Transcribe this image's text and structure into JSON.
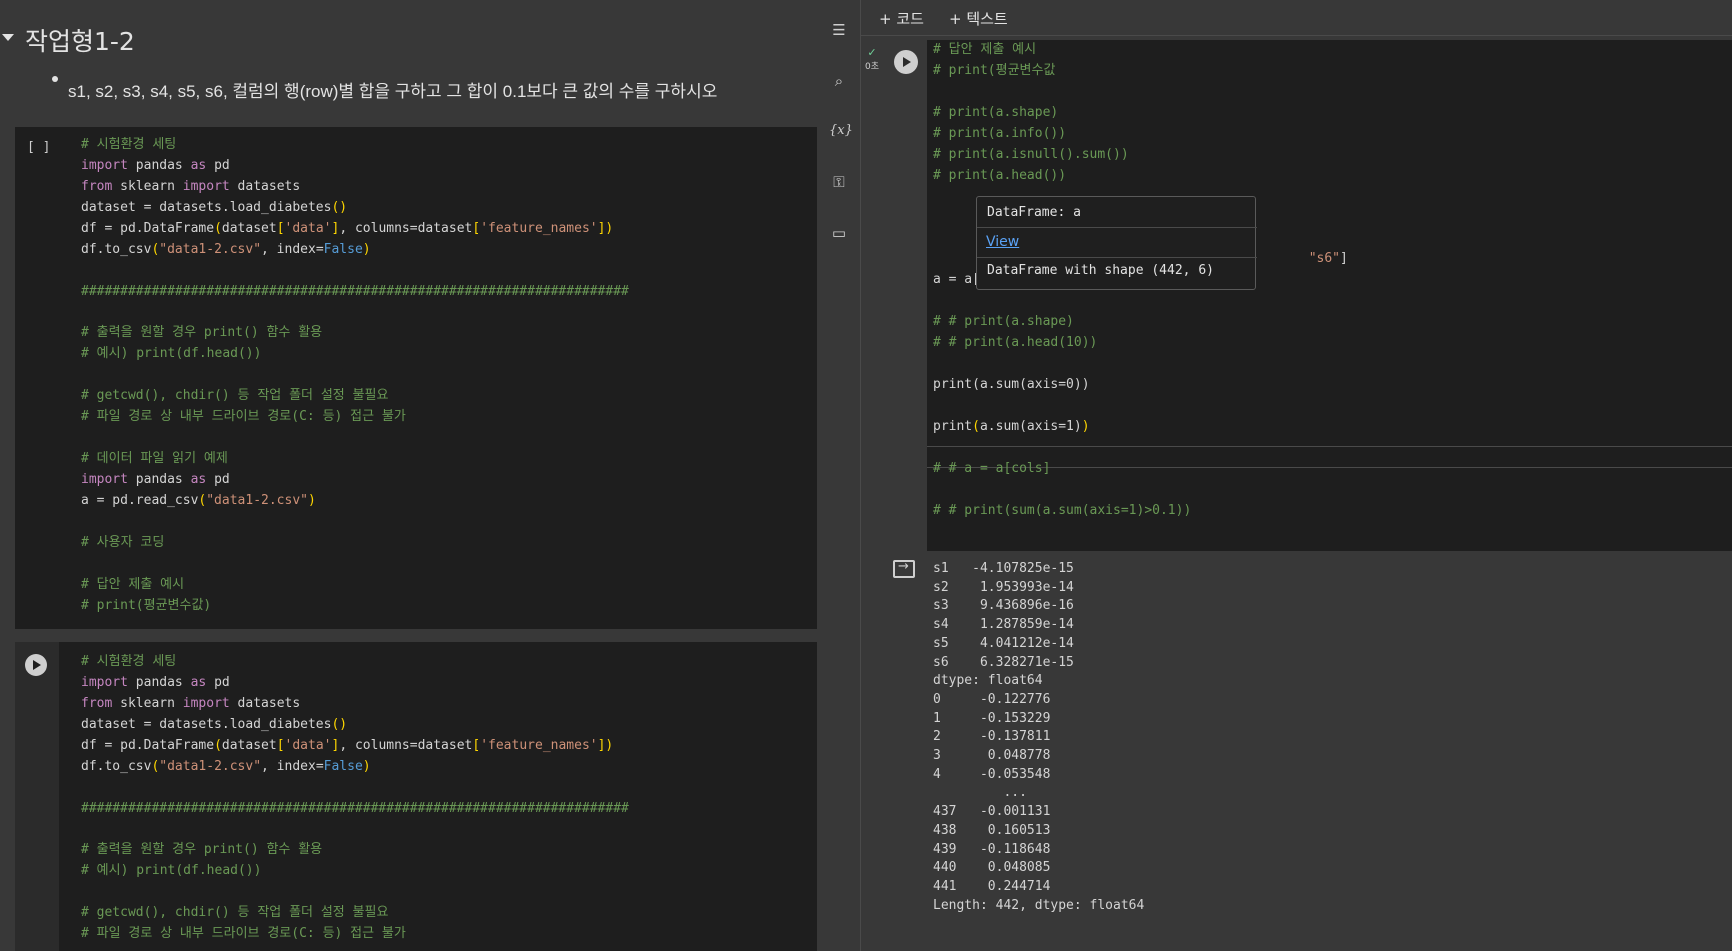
{
  "notebook": {
    "section_title": "작업형1-2",
    "section_description": "s1, s2, s3, s4, s5, s6, 컬럼의 행(row)별 합을 구하고 그 합이 0.1보다 큰 값의 수를 구하시오",
    "cell1_bracket": "[ ]"
  },
  "toolbar": {
    "add_code": "+ 코드",
    "add_text": "+ 텍스트"
  },
  "sidebar_icons": [
    "toc-icon",
    "search-icon",
    "variables-icon",
    "key-icon",
    "folder-icon"
  ],
  "right_cell": {
    "exec_status": "0초",
    "output_lines": [
      "s1   -4.107825e-15",
      "s2    1.953993e-14",
      "s3    9.436896e-16",
      "s4    1.287859e-14",
      "s5    4.041212e-14",
      "s6    6.328271e-15",
      "dtype: float64",
      "0     -0.122776",
      "1     -0.153229",
      "2     -0.137811",
      "3      0.048778",
      "4     -0.053548",
      "         ...",
      "437   -0.001131",
      "438    0.160513",
      "439   -0.118648",
      "440    0.048085",
      "441    0.244714",
      "Length: 442, dtype: float64"
    ]
  },
  "tooltip": {
    "title": "DataFrame: a",
    "link": "View",
    "shape": "DataFrame with shape (442, 6)"
  },
  "code": {
    "cell1": [
      [
        [
          "cm",
          "# 시험환경 세팅"
        ]
      ],
      [
        [
          "kw",
          "import"
        ],
        [
          "t",
          " pandas "
        ],
        [
          "kw",
          "as"
        ],
        [
          "t",
          " pd"
        ]
      ],
      [
        [
          "kw",
          "from"
        ],
        [
          "t",
          " sklearn "
        ],
        [
          "kw",
          "import"
        ],
        [
          "t",
          " datasets"
        ]
      ],
      [
        [
          "t",
          "dataset = datasets.load_diabetes"
        ],
        [
          "br",
          "()"
        ]
      ],
      [
        [
          "t",
          "df = pd.DataFrame"
        ],
        [
          "br",
          "("
        ],
        [
          "t",
          "dataset"
        ],
        [
          "br",
          "["
        ],
        [
          "str",
          "'data'"
        ],
        [
          "br",
          "]"
        ],
        [
          "t",
          ", columns=dataset"
        ],
        [
          "br",
          "["
        ],
        [
          "str",
          "'feature_names'"
        ],
        [
          "br",
          "])"
        ]
      ],
      [
        [
          "t",
          "df.to_csv"
        ],
        [
          "br",
          "("
        ],
        [
          "str",
          "\"data1-2.csv\""
        ],
        [
          "t",
          ", index="
        ],
        [
          "kwc",
          "False"
        ],
        [
          "br",
          ")"
        ]
      ],
      [
        [
          "t",
          ""
        ]
      ],
      [
        [
          "cm",
          "######################################################################"
        ]
      ],
      [
        [
          "t",
          ""
        ]
      ],
      [
        [
          "cm",
          "# 출력을 원할 경우 print() 함수 활용"
        ]
      ],
      [
        [
          "cm",
          "# 예시) print(df.head())"
        ]
      ],
      [
        [
          "t",
          ""
        ]
      ],
      [
        [
          "cm",
          "# getcwd(), chdir() 등 작업 폴더 설정 불필요"
        ]
      ],
      [
        [
          "cm",
          "# 파일 경로 상 내부 드라이브 경로(C: 등) 접근 불가"
        ]
      ],
      [
        [
          "t",
          ""
        ]
      ],
      [
        [
          "cm",
          "# 데이터 파일 읽기 예제"
        ]
      ],
      [
        [
          "kw",
          "import"
        ],
        [
          "t",
          " pandas "
        ],
        [
          "kw",
          "as"
        ],
        [
          "t",
          " pd"
        ]
      ],
      [
        [
          "t",
          "a = pd.read_csv"
        ],
        [
          "br",
          "("
        ],
        [
          "str",
          "\"data1-2.csv\""
        ],
        [
          "br",
          ")"
        ]
      ],
      [
        [
          "t",
          ""
        ]
      ],
      [
        [
          "cm",
          "# 사용자 코딩"
        ]
      ],
      [
        [
          "t",
          ""
        ]
      ],
      [
        [
          "cm",
          "# 답안 제출 예시"
        ]
      ],
      [
        [
          "cm",
          "# print(평균변수값)"
        ]
      ]
    ],
    "cell2": [
      [
        [
          "cm",
          "# 시험환경 세팅"
        ]
      ],
      [
        [
          "kw",
          "import"
        ],
        [
          "t",
          " pandas "
        ],
        [
          "kw",
          "as"
        ],
        [
          "t",
          " pd"
        ]
      ],
      [
        [
          "kw",
          "from"
        ],
        [
          "t",
          " sklearn "
        ],
        [
          "kw",
          "import"
        ],
        [
          "t",
          " datasets"
        ]
      ],
      [
        [
          "t",
          "dataset = datasets.load_diabetes"
        ],
        [
          "br",
          "()"
        ]
      ],
      [
        [
          "t",
          "df = pd.DataFrame"
        ],
        [
          "br",
          "("
        ],
        [
          "t",
          "dataset"
        ],
        [
          "br",
          "["
        ],
        [
          "str",
          "'data'"
        ],
        [
          "br",
          "]"
        ],
        [
          "t",
          ", columns=dataset"
        ],
        [
          "br",
          "["
        ],
        [
          "str",
          "'feature_names'"
        ],
        [
          "br",
          "])"
        ]
      ],
      [
        [
          "t",
          "df.to_csv"
        ],
        [
          "br",
          "("
        ],
        [
          "str",
          "\"data1-2.csv\""
        ],
        [
          "t",
          ", index="
        ],
        [
          "kwc",
          "False"
        ],
        [
          "br",
          ")"
        ]
      ],
      [
        [
          "t",
          ""
        ]
      ],
      [
        [
          "cm",
          "######################################################################"
        ]
      ],
      [
        [
          "t",
          ""
        ]
      ],
      [
        [
          "cm",
          "# 출력을 원할 경우 print() 함수 활용"
        ]
      ],
      [
        [
          "cm",
          "# 예시) print(df.head())"
        ]
      ],
      [
        [
          "t",
          ""
        ]
      ],
      [
        [
          "cm",
          "# getcwd(), chdir() 등 작업 폴더 설정 불필요"
        ]
      ],
      [
        [
          "cm",
          "# 파일 경로 상 내부 드라이브 경로(C: 등) 접근 불가"
        ]
      ]
    ],
    "right": [
      [
        [
          "cm",
          "# 답안 제출 예시"
        ]
      ],
      [
        [
          "cm",
          "# print(평균변수값"
        ]
      ],
      [
        [
          "t",
          ""
        ]
      ],
      [
        [
          "cm",
          "# print(a.shape)"
        ]
      ],
      [
        [
          "cm",
          "# print(a.info())"
        ]
      ],
      [
        [
          "cm",
          "# print(a.isnull().sum())"
        ]
      ],
      [
        [
          "cm",
          "# print(a.head())"
        ]
      ],
      [
        [
          "t",
          ""
        ]
      ],
      [
        [
          "t",
          ""
        ]
      ],
      [
        [
          "t",
          ""
        ]
      ],
      [
        [
          "t",
          "                                                "
        ],
        [
          "str",
          "\"s6\""
        ],
        [
          "t",
          "]"
        ]
      ],
      [
        [
          "t",
          "a = a"
        ],
        [
          "t",
          "["
        ],
        [
          "sq",
          "cols"
        ],
        [
          "t",
          "]"
        ]
      ],
      [
        [
          "t",
          ""
        ]
      ],
      [
        [
          "cm",
          "# # print(a.shape)"
        ]
      ],
      [
        [
          "cm",
          "# # print(a.head(10))"
        ]
      ],
      [
        [
          "t",
          ""
        ]
      ],
      [
        [
          "t",
          "print(a.sum(axis=0))"
        ]
      ],
      [
        [
          "t",
          ""
        ]
      ],
      [
        [
          "t",
          "print"
        ],
        [
          "br",
          "("
        ],
        [
          "t",
          "a.sum(axis=1)"
        ],
        [
          "br",
          ")"
        ]
      ],
      [
        [
          "t",
          ""
        ]
      ],
      [
        [
          "cm",
          "# # a = a[cols]"
        ]
      ],
      [
        [
          "t",
          ""
        ]
      ],
      [
        [
          "cm",
          "# # print(sum(a.sum(axis=1)>0.1))"
        ]
      ]
    ]
  }
}
